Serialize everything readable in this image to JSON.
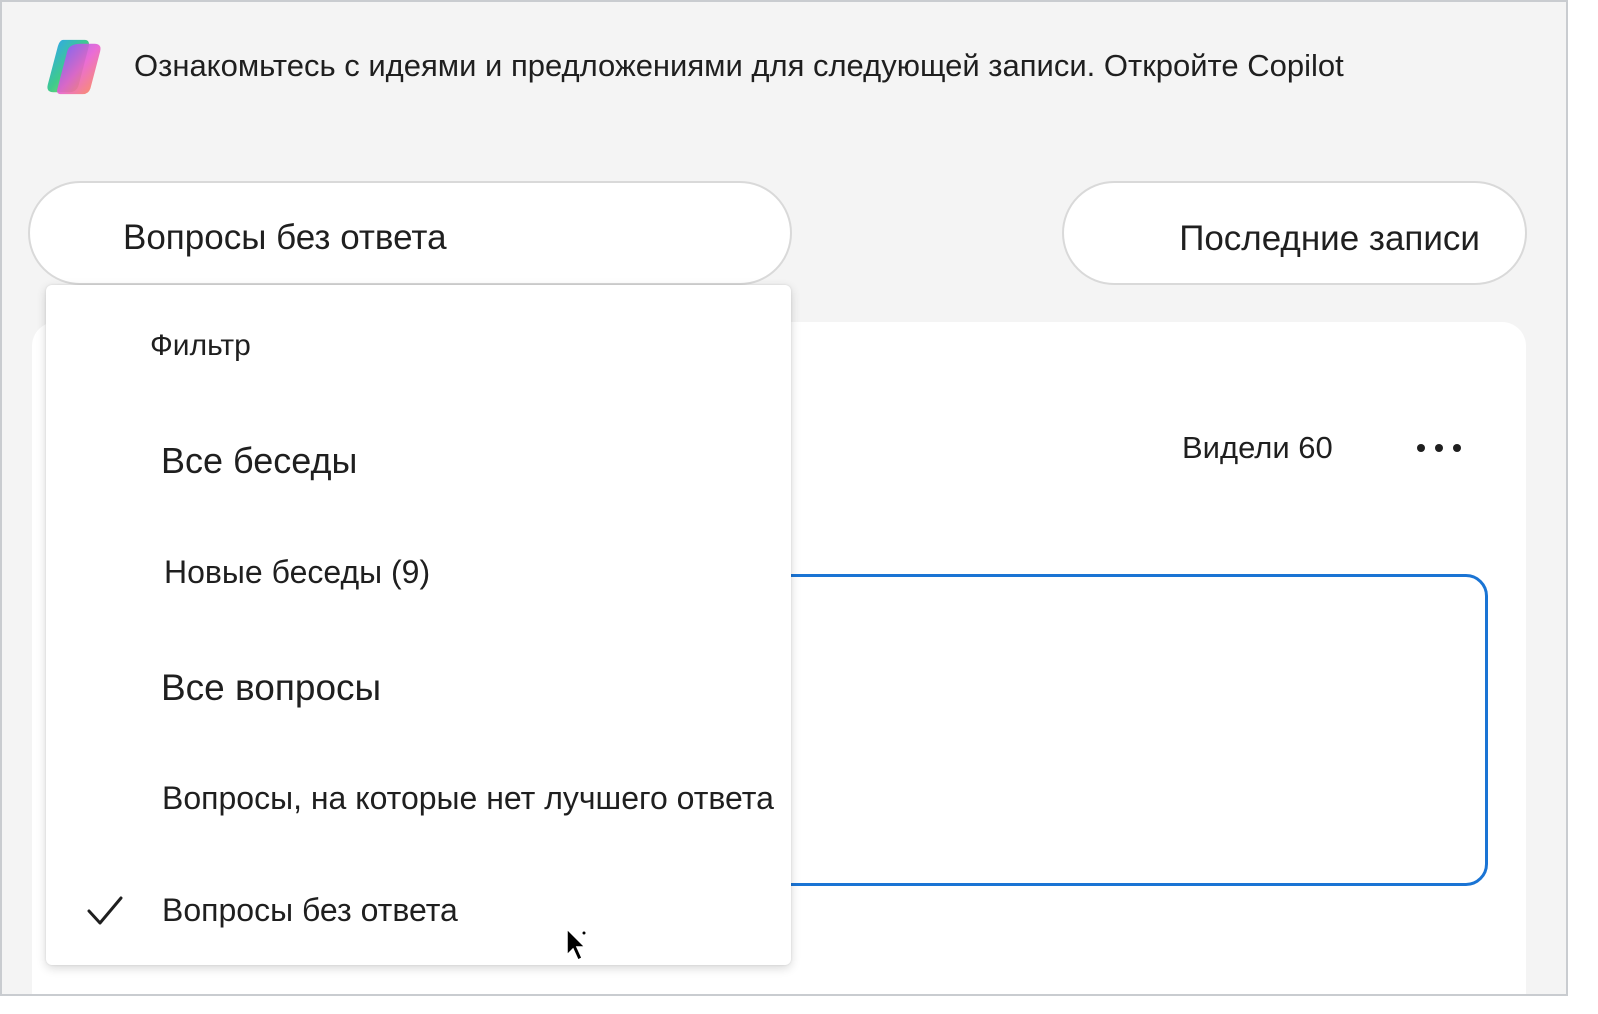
{
  "banner": {
    "icon": "copilot-logo-icon",
    "text": "Ознакомьтесь с идеями и предложениями для следующей записи. Откройте Copilot"
  },
  "filter_pill": {
    "label": "Вопросы без ответа"
  },
  "sort_pill": {
    "label": "Последние записи"
  },
  "card": {
    "seen_label": "Видели 60",
    "more_icon": "more-horizontal-icon"
  },
  "dropdown": {
    "header": "Фильтр",
    "items": [
      {
        "label": "Все беседы",
        "selected": false
      },
      {
        "label": "Новые беседы (9)",
        "selected": false
      },
      {
        "label": "Все вопросы",
        "selected": false
      },
      {
        "label": "Вопросы, на которые нет лучшего ответа",
        "selected": false
      },
      {
        "label": "Вопросы без ответа",
        "selected": true
      }
    ],
    "check_icon": "checkmark-icon"
  },
  "colors": {
    "page_background": "#f4f4f4",
    "surface": "#ffffff",
    "accent_border": "#1a74d4",
    "text": "#1f1f1f"
  }
}
